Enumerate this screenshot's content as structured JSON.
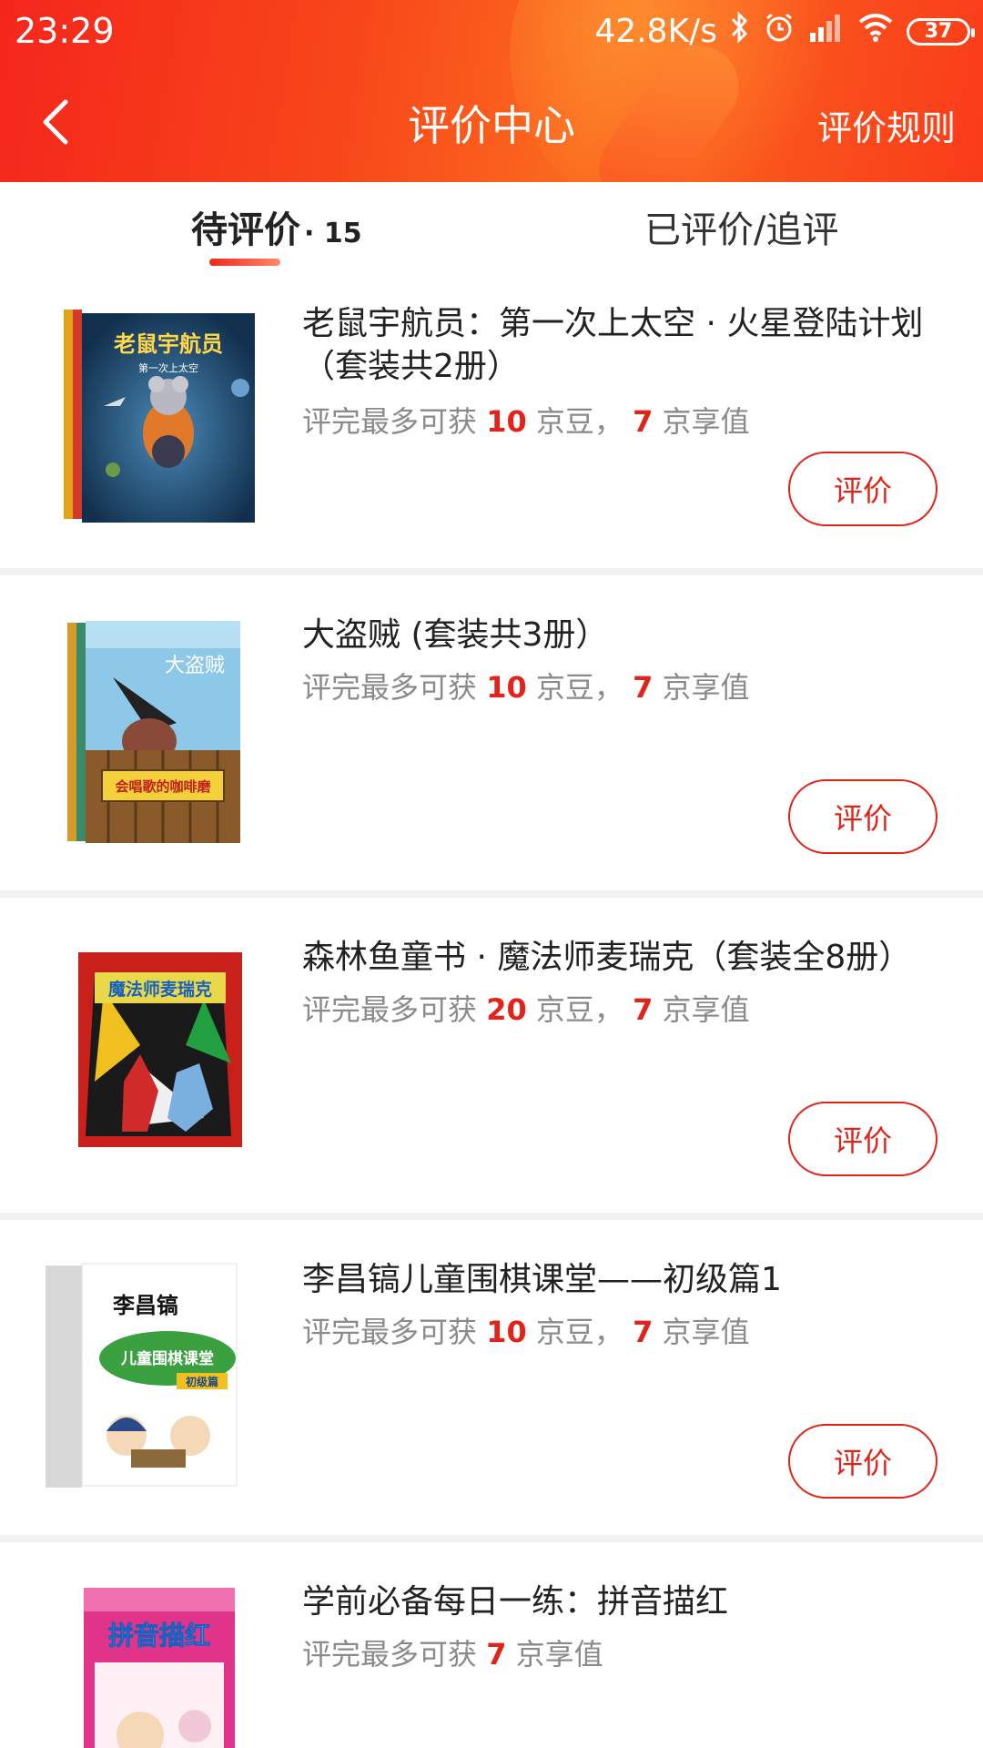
{
  "status_bar": {
    "time": "23:29",
    "net_speed": "42.8K/s",
    "battery": "37",
    "icons": [
      "bluetooth-icon",
      "alarm-icon",
      "signal-icon",
      "wifi-icon",
      "battery-icon"
    ]
  },
  "nav": {
    "title": "评价中心",
    "rules_label": "评价规则",
    "back_icon": "back-arrow-icon"
  },
  "tabs": {
    "pending_label": "待评价",
    "pending_count": "· 15",
    "reviewed_label": "已评价/追评"
  },
  "colors": {
    "accent": "#e2231a",
    "header_start": "#f4261c",
    "header_end": "#fb6a1e"
  },
  "items": [
    {
      "title_line1": "老鼠宇航员：第一次上太空 · 火星登陆计划",
      "title_line2": "（套装共2册）",
      "reward_prefix": "评完最多可获",
      "beans": "10",
      "beans_unit": "京豆，",
      "value": "7",
      "value_unit": "京享值",
      "button": "评价",
      "cover_text": "老鼠宇航员",
      "cover_sub": "第一次上太空"
    },
    {
      "title_line1": "大盗贼 (套装共3册）",
      "reward_prefix": "评完最多可获",
      "beans": "10",
      "beans_unit": "京豆，",
      "value": "7",
      "value_unit": "京享值",
      "button": "评价",
      "cover_text": "大盗贼",
      "cover_sub": "会唱歌的咖啡磨"
    },
    {
      "title_line1": "森林鱼童书 · 魔法师麦瑞克（套装全8册）",
      "reward_prefix": "评完最多可获",
      "beans": "20",
      "beans_unit": "京豆，",
      "value": "7",
      "value_unit": "京享值",
      "button": "评价",
      "cover_text": "魔法师麦瑞克"
    },
    {
      "title_line1": "李昌镐儿童围棋课堂——初级篇1",
      "reward_prefix": "评完最多可获",
      "beans": "10",
      "beans_unit": "京豆，",
      "value": "7",
      "value_unit": "京享值",
      "button": "评价",
      "cover_text": "李昌镐",
      "cover_sub": "儿童围棋课堂",
      "cover_sub2": "初级篇"
    },
    {
      "title_line1": "学前必备每日一练：拼音描红",
      "reward_prefix": "评完最多可获",
      "value": "7",
      "value_unit": "京享值",
      "cover_text": "拼音描红"
    }
  ]
}
